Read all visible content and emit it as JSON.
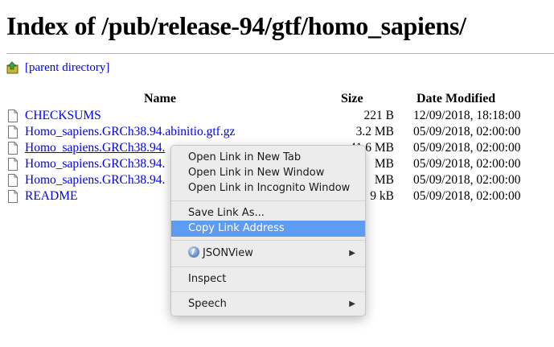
{
  "page": {
    "title": "Index of /pub/release-94/gtf/homo_sapiens/",
    "parent_link": "[parent directory]"
  },
  "table": {
    "headers": {
      "name": "Name",
      "size": "Size",
      "date": "Date Modified"
    },
    "rows": [
      {
        "name": "CHECKSUMS",
        "size": "221 B",
        "date": "12/09/2018, 18:18:00"
      },
      {
        "name": "Homo_sapiens.GRCh38.94.abinitio.gtf.gz",
        "size": "3.2 MB",
        "date": "05/09/2018, 02:00:00"
      },
      {
        "name": "Homo_sapiens.GRCh38.94.",
        "size": "41.6 MB",
        "date": "05/09/2018, 02:00:00"
      },
      {
        "name": "Homo_sapiens.GRCh38.94.",
        "size": "MB",
        "date": "05/09/2018, 02:00:00"
      },
      {
        "name": "Homo_sapiens.GRCh38.94.",
        "size": "MB",
        "date": "05/09/2018, 02:00:00"
      },
      {
        "name": "README",
        "size": "9 kB",
        "date": "05/09/2018, 02:00:00"
      }
    ]
  },
  "context_menu": {
    "open_new_tab": "Open Link in New Tab",
    "open_new_window": "Open Link in New Window",
    "open_incognito": "Open Link in Incognito Window",
    "save_link_as": "Save Link As...",
    "copy_link_address": "Copy Link Address",
    "jsonview": "JSONView",
    "inspect": "Inspect",
    "speech": "Speech",
    "submenu_arrow": "▶",
    "selected_color": "#5e9bf2"
  },
  "colors": {
    "link": "#0000ee",
    "menu_bg": "#ececec"
  }
}
